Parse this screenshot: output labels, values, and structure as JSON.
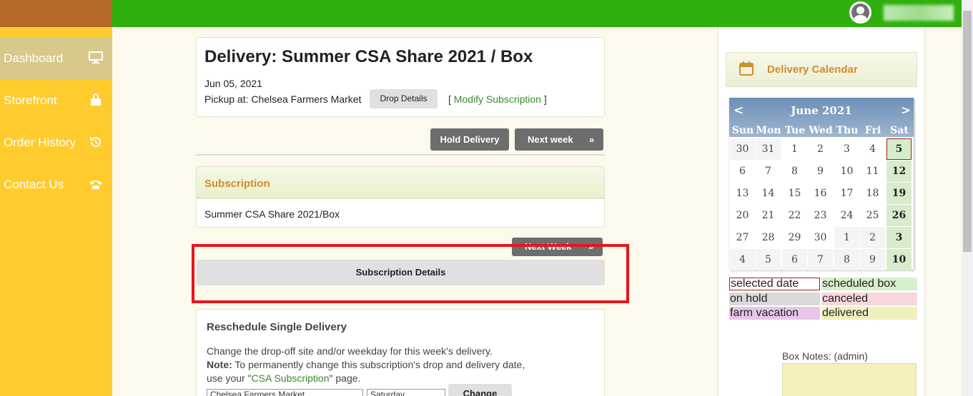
{
  "sidebar": {
    "items": [
      {
        "label": "Dashboard",
        "icon": "desktop-icon"
      },
      {
        "label": "Storefront",
        "icon": "shopping-bag-icon"
      },
      {
        "label": "Order History",
        "icon": "history-icon"
      },
      {
        "label": "Contact Us",
        "icon": "phone-icon"
      }
    ]
  },
  "delivery": {
    "title": "Delivery: Summer CSA Share 2021 / Box",
    "date": "Jun 05, 2021",
    "pickup_prefix": "Pickup at: ",
    "pickup_location": "Chelsea Farmers Market",
    "drop_details_label": "Drop Details",
    "modify_open": "[ ",
    "modify_label": "Modify Subscription",
    "modify_close": " ]",
    "hold_label": "Hold Delivery",
    "next_week_label": "Next week",
    "next_week_arrow": "»"
  },
  "subscription": {
    "heading": "Subscription",
    "name": "Summer CSA Share 2021/Box",
    "next_week_label": "Next Week",
    "next_week_arrow": "»",
    "details_label": "Subscription Details"
  },
  "reschedule": {
    "title": "Reschedule Single Delivery",
    "line1": "Change the drop-off site and/or weekday for this week's delivery.",
    "note_label": "Note:",
    "note_text": " To permanently change this subscription's drop and delivery date,",
    "line3_prefix": "use your \"",
    "line3_link": "CSA Subscription",
    "line3_suffix": "\" page.",
    "site_value": "Chelsea Farmers Market",
    "day_value": "Saturday",
    "change_label": "Change"
  },
  "calendar": {
    "header": "Delivery Calendar",
    "month": "June 2021",
    "prev": "<",
    "next": ">",
    "weekdays": [
      "Sun",
      "Mon",
      "Tue",
      "Wed",
      "Thu",
      "Fri",
      "Sat"
    ],
    "weeks": [
      [
        "30",
        "31",
        "1",
        "2",
        "3",
        "4",
        "5"
      ],
      [
        "6",
        "7",
        "8",
        "9",
        "10",
        "11",
        "12"
      ],
      [
        "13",
        "14",
        "15",
        "16",
        "17",
        "18",
        "19"
      ],
      [
        "20",
        "21",
        "22",
        "23",
        "24",
        "25",
        "26"
      ],
      [
        "27",
        "28",
        "29",
        "30",
        "1",
        "2",
        "3"
      ],
      [
        "4",
        "5",
        "6",
        "7",
        "8",
        "9",
        "10"
      ]
    ],
    "selected": "5"
  },
  "legend": {
    "selected": "selected date",
    "scheduled": "scheduled box",
    "hold": "on hold",
    "canceled": "canceled",
    "vacation": "farm vacation",
    "delivered": "delivered"
  },
  "notes": {
    "label": "Box Notes: (admin)"
  },
  "colors": {
    "topbar": "#2fb00f",
    "brand": "#b4692a",
    "sidebar": "#ffcb2d",
    "accent_orange": "#d28d2b",
    "link_green": "#3a8a2b",
    "highlight_red": "#e8141b"
  }
}
